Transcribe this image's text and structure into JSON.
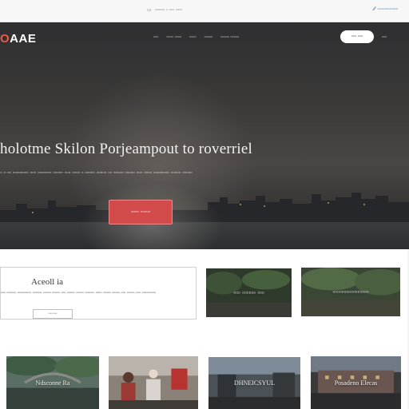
{
  "topbar": {
    "center_text": "▫▫▫▫▫▫ ▫ ▫▫▫ ▫▫▫▫",
    "right_text": "▫▫▫▫▫▫▫▫▫▫▫▫"
  },
  "header": {
    "logo_accent": "O",
    "logo_text": "AAE",
    "nav": [
      "▫▫▫",
      "▫▫▫▫ ▫▫▫▫",
      "▫▫▫▫",
      "▫▫▫▫▫",
      "▫▫▫▫▫ ▫▫▫▫▫"
    ],
    "cta_label": "▫▫▫ ▫▫▫",
    "extra_label": "▫▫▫"
  },
  "hero": {
    "title": "holotme Skilon Porjeampout to roverriel",
    "subtitle": "▫ ▫ ▫▫ ▫▫▫▫▫▫▫▫ ▫▫▫ ▫▫▫▫▫▫▫ ▫▫▫▫▫ ▫▫▫ ▫▫▫▫ ▫ ▫▫▫▫▫ ▫▫▫▫▫ ▫▫ ▫▫▫▫▫ ▫▫▫▫▫ ▫▫▫ ▫▫▫▫ ▫▫▫▫▫▫▫▫ ▫▫▫▫▫ ▫▫▫▫▫",
    "button_label": "▫▫▫▫ ▫▫▫▫▫"
  },
  "about": {
    "title": "Aceoll ia",
    "text": "▫▫▫ ▫▫▫▫▫▫ ▫▫▫▫▫▫▫▫▫ ▫▫▫▫▫▫ ▫▫▫▫▫ ▫▫▫▫▫ ▫▫▫ ▫▫▫▫▫ ▫▫▫▫▫ ▫▫▫▫▫▫ ▫▫▫▫ ▫▫▫▫▫ ▫▫▫▫▫ ▫▫▫ ▫▫▫▫▫ ▫▫▫ ▫▫▫▫▫▫▫▫▫",
    "button_label": "▫▫▫▫▫▫"
  },
  "gallery": [
    {
      "caption": "▫▫▫ ▫▫▫▫▫▫ ▫▫▫"
    },
    {
      "caption": "▫▫▫▫▫▫▫▫▫▫▫▫▫▫▫▫"
    },
    {
      "caption": "Ndsconne Ra"
    },
    {
      "caption": ""
    },
    {
      "caption": "DHNEICSYUL"
    },
    {
      "caption": "Posadeno Elecas"
    }
  ],
  "colors": {
    "accent": "#ec5a43",
    "hero_button": "#d24a4a",
    "topbar_link": "#3c7a9a"
  }
}
